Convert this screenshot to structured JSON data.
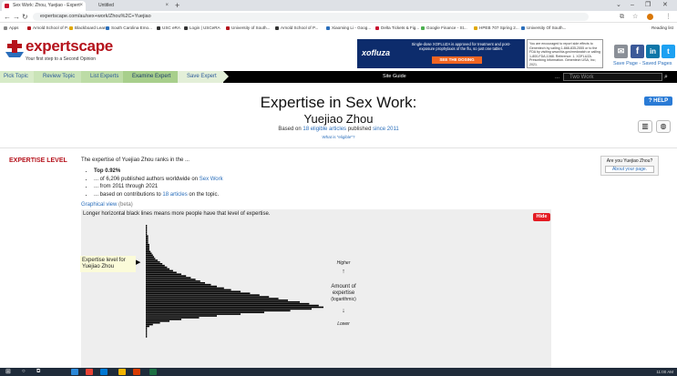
{
  "browser": {
    "tabs": [
      {
        "label": "Sex Work: Zhou, Yuejiao - Expert",
        "active": true
      },
      {
        "label": "Untitled",
        "active": false
      }
    ],
    "url": "expertscape.com/au/sex+work/Zhou%2C+Yuejiao",
    "bookmarks": [
      "Apps",
      "Arnold School of P...",
      "Blackboard Learn",
      "South Carolina Emo...",
      "USC eRA",
      "Login | USCeRA",
      "University of South...",
      "Arnold School of P...",
      "Xiaoming Li - Goog...",
      "Delta Tickets & Fig...",
      "Google Finance - St...",
      "HPEB 707 Spring 2...",
      "University Of South..."
    ],
    "reading_list": "Reading list"
  },
  "site": {
    "logo_text": "expertscape",
    "tagline": "Your first step to a Second Opinion",
    "ad": {
      "brand": "xofluza",
      "text": "Single-dose XOFLUZA is approved for treatment and post-exposure prophylaxis of the flu, so just one tablet.",
      "button": "SEE THE DOSING"
    },
    "ad2_text": "You are encouraged to report side effects to Genentech by calling 1-888-835-2555 or to the FDA by visiting www.fda.gov/medwatch or calling 1-800-FDA-1088. Reference: 1. XOFLUZA. Prescribing Information. Genentech USA, Inc; 2021.",
    "save_page": "Save Page",
    "saved_pages": "Saved Pages",
    "separator": "-"
  },
  "nav": {
    "crumbs": [
      "Pick Topic",
      "Review Topic",
      "List Experts",
      "Examine Expert",
      "Save Expert"
    ],
    "site_guide": "Site Guide",
    "search_placeholder": "Two Work",
    "search_dots": "..."
  },
  "main": {
    "title": "Expertise in Sex Work:",
    "expert_name": "Yuejiao Zhou",
    "based_on_prefix": "Based on",
    "article_count_link": "18 eligible articles",
    "based_on_mid": "published",
    "since_link": "since 2011",
    "what_eligible": "What is \"eligible\"?",
    "help": "HELP"
  },
  "expertise": {
    "heading": "EXPERTISE LEVEL",
    "desc": "The expertise of Yuejiao Zhou ranks in the ...",
    "bullet1": "Top 0.92%",
    "bullet2_prefix": "... of 6,206 published authors worldwide on",
    "bullet2_link": "Sex Work",
    "bullet3": "... from 2011 through 2021",
    "bullet4_prefix": "... based on contributions to",
    "bullet4_link": "18 articles",
    "bullet4_suffix": "on the topic.",
    "sidebox_q": "Are you Yuejiao Zhou?",
    "sidebox_btn": "About your page."
  },
  "graph": {
    "link": "Graphical view",
    "beta": "(beta)",
    "hint": "Longer horizontal black lines means more people have that level of expertise.",
    "hide": "Hide",
    "marker_label": "Expertise level for Yuejiao Zhou",
    "higher": "Higher",
    "up_arrow": "↑",
    "amount": "Amount of expertise",
    "log": "(logarithmic)",
    "down_arrow": "↓",
    "lower": "Lower"
  },
  "chart_data": {
    "type": "bar",
    "orientation": "horizontal",
    "values": [
      1,
      1,
      1,
      1,
      1,
      1,
      2,
      2,
      2,
      2,
      2,
      3,
      3,
      3,
      3,
      4,
      5,
      6,
      7,
      8,
      10,
      12,
      14,
      16,
      18,
      20,
      23,
      26,
      30,
      34,
      38,
      42,
      46,
      50,
      55,
      60,
      66,
      72,
      80,
      88,
      96,
      104,
      112,
      120,
      130,
      138,
      146,
      150,
      140,
      122,
      100,
      80,
      60,
      45,
      30,
      20,
      12,
      6,
      3,
      1,
      1,
      1,
      1,
      1,
      1
    ],
    "marker_index": 13
  },
  "taskbar": {
    "clock": "11:00 AM"
  }
}
